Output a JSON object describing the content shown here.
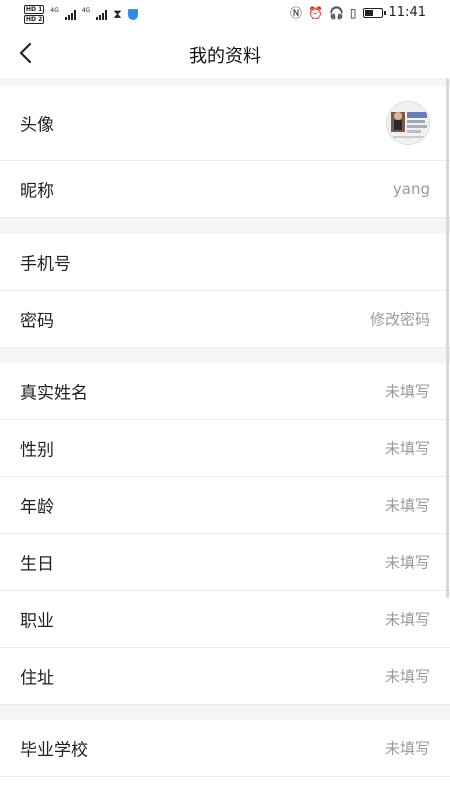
{
  "status_bar": {
    "sim1": "HD 1",
    "sim2": "HD 2",
    "net1": "4G",
    "net2": "4G",
    "time": "11:41",
    "battery_level": 0.6,
    "icons": [
      "nfc-icon",
      "alarm-icon",
      "headphones-icon",
      "vibrate-icon",
      "battery-icon"
    ]
  },
  "header": {
    "title": "我的资料",
    "back_icon": "chevron-left-icon"
  },
  "rows": [
    {
      "label": "头像",
      "value": ""
    },
    {
      "label": "昵称",
      "value": "yang"
    },
    {
      "label": "手机号",
      "value": ""
    },
    {
      "label": "密码",
      "value": "修改密码"
    },
    {
      "label": "真实姓名",
      "value": "未填写"
    },
    {
      "label": "性别",
      "value": "未填写"
    },
    {
      "label": "年龄",
      "value": "未填写"
    },
    {
      "label": "生日",
      "value": "未填写"
    },
    {
      "label": "职业",
      "value": "未填写"
    },
    {
      "label": "住址",
      "value": "未填写"
    },
    {
      "label": "毕业学校",
      "value": "未填写"
    }
  ],
  "colors": {
    "background": "#f5f5f5",
    "row_background": "#ffffff",
    "label": "#222222",
    "value": "#9a9a9a",
    "divider": "#ececec"
  }
}
